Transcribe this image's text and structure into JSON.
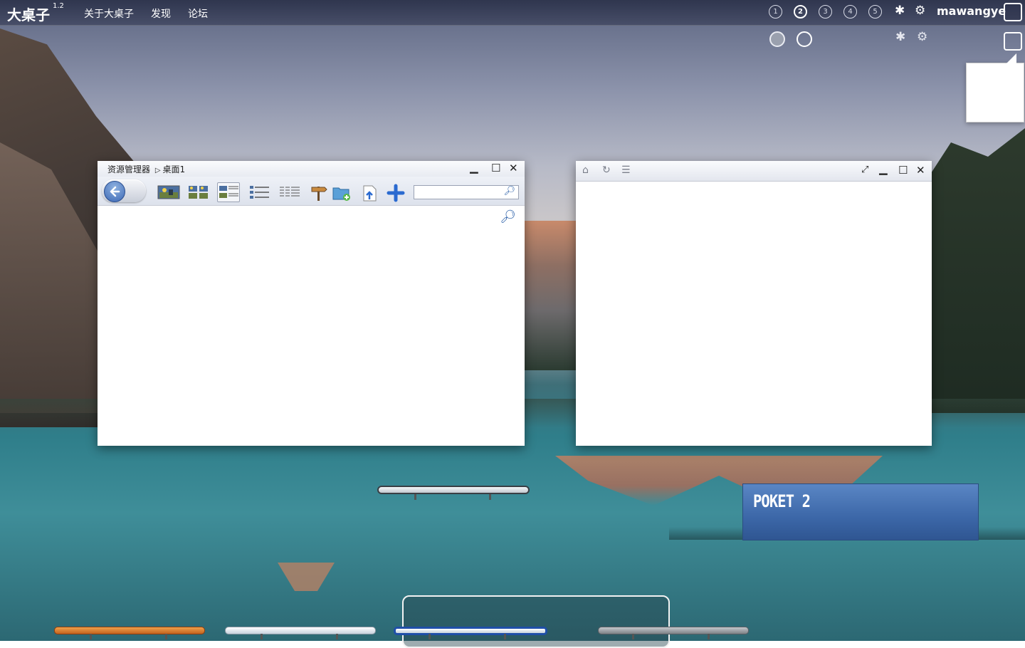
{
  "app": {
    "logo": "大桌子",
    "version": "1.2"
  },
  "nav": [
    "关于大桌子",
    "发现",
    "论坛"
  ],
  "desktops": {
    "numbers": [
      "1",
      "2",
      "3",
      "4",
      "5"
    ],
    "active_index": 1
  },
  "topbar": {
    "username": "mawangye",
    "icons": [
      "spark-icon",
      "gear-icon"
    ]
  },
  "file_manager": {
    "breadcrumb_root": "资源管理器",
    "breadcrumb_sep": "▷",
    "breadcrumb_current": "桌面1",
    "search_value": "",
    "toolbar_icons": [
      "large-thumbnail-view-icon",
      "thumbnail-view-icon",
      "detail-thumbnail-view-icon",
      "list-view-icon",
      "small-list-view-icon",
      "signpost-icon",
      "new-folder-icon",
      "upload-icon",
      "add-icon"
    ],
    "selected_view": 2
  },
  "browser": {
    "icons": [
      "home-icon",
      "refresh-icon",
      "menu-icon",
      "fullscreen-icon",
      "minimize-icon",
      "maximize-icon",
      "close-icon"
    ]
  },
  "pocket": {
    "label": "POKET 2",
    "color": "#4a76b6"
  },
  "shelves": {
    "colors": [
      "#d9782e",
      "#dde6ee",
      "#2a5fb0",
      "#9b9fa4"
    ]
  }
}
